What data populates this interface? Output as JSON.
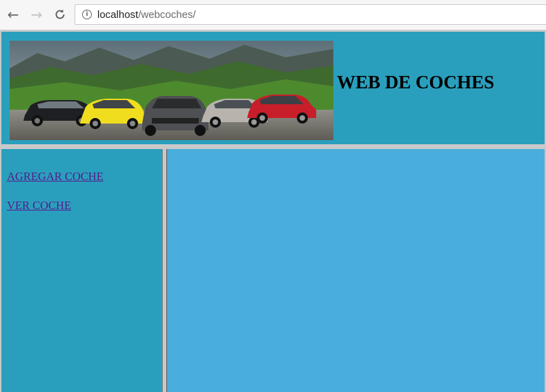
{
  "browser": {
    "url_host": "localhost",
    "url_path": "/webcoches/",
    "info_icon": "info-icon"
  },
  "header": {
    "title": "WEB DE COCHES",
    "banner_image": "cars-banner"
  },
  "menu": {
    "items": [
      {
        "label": "AGREGAR COCHE "
      },
      {
        "label": "VER COCHE"
      }
    ]
  },
  "colors": {
    "header_bg": "#2a9fbd",
    "menu_bg": "#2a9fbd",
    "content_bg": "#4aaedc",
    "link": "#551a8b"
  }
}
